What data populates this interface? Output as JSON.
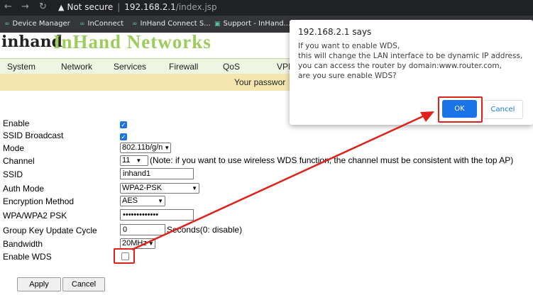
{
  "browser": {
    "security": "Not secure",
    "host": "192.168.2.1",
    "path": "/index.jsp",
    "bookmarks": [
      "Device Manager",
      "InConnect",
      "InHand Connect S...",
      "Support - InHand..."
    ]
  },
  "header": {
    "logo": "inhand",
    "brand": "InHand Networks"
  },
  "menu": {
    "items": [
      "System",
      "Network",
      "Services",
      "Firewall",
      "QoS",
      "VPN"
    ]
  },
  "notice": "Your passwor",
  "form": {
    "enable_label": "Enable",
    "ssid_broadcast_label": "SSID Broadcast",
    "mode_label": "Mode",
    "mode_value": "802.11b/g/n",
    "channel_label": "Channel",
    "channel_value": "11",
    "channel_note": "(Note: if you want to use wireless WDS function, the channel must be consistent with the top AP)",
    "ssid_label": "SSID",
    "ssid_value": "inhand1",
    "auth_label": "Auth Mode",
    "auth_value": "WPA2-PSK",
    "enc_label": "Encryption Method",
    "enc_value": "AES",
    "psk_label": "WPA/WPA2 PSK",
    "psk_value": "•••••••••••••",
    "gkut_label": "Group Key Update Cycle",
    "gkut_value": "0",
    "gkut_suffix": "Seconds(0: disable)",
    "bandwidth_label": "Bandwidth",
    "bandwidth_value": "20MHz",
    "wds_label": "Enable WDS",
    "apply_label": "Apply",
    "cancel_label": "Cancel"
  },
  "dialog": {
    "title": "192.168.2.1 says",
    "lines": [
      "If you want to enable WDS,",
      " this will change the LAN interface to be dynamic IP address,",
      " you can access the router by domain:www.router.com,",
      " are you sure enable WDS?"
    ],
    "ok_label": "OK",
    "cancel_label": "Cancel"
  },
  "colors": {
    "brand_green": "#9ccd5c",
    "accent_blue": "#1a73e8",
    "annotation_red": "#e0201b"
  }
}
